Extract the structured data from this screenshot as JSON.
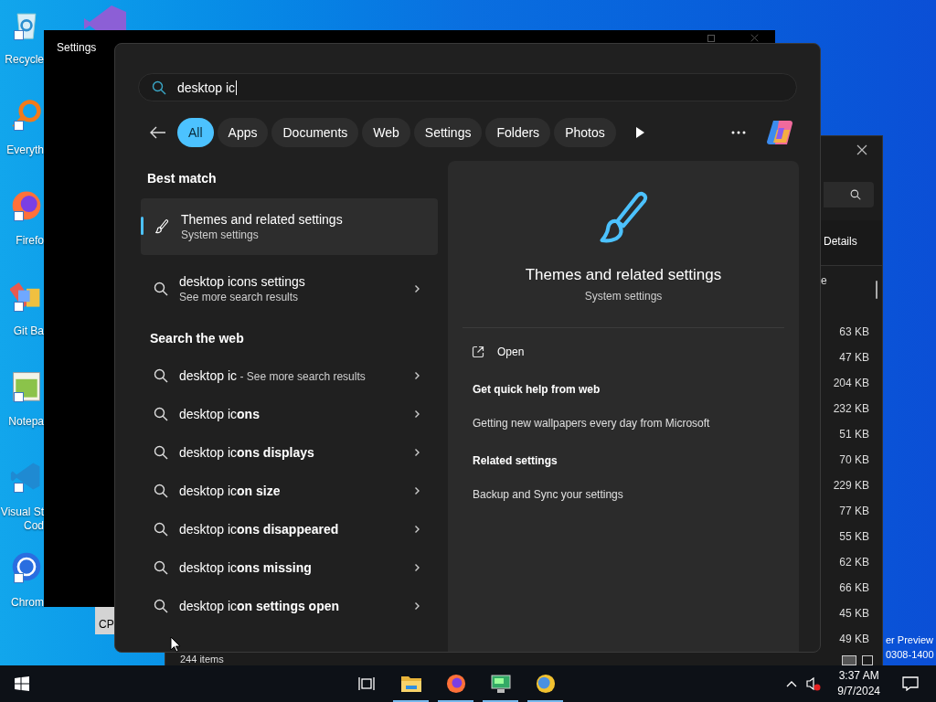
{
  "desktop": {
    "icons": [
      {
        "kind": "recycle-bin",
        "label": "Recycle"
      },
      {
        "kind": "magnifier",
        "label": "Everyth"
      },
      {
        "kind": "firefox",
        "label": "Firefo"
      },
      {
        "kind": "git",
        "label": "Git Ba"
      },
      {
        "kind": "notepad",
        "label": "Notepa"
      },
      {
        "kind": "vscode",
        "label": "Visual St\nCod"
      },
      {
        "kind": "chrome",
        "label": "Chrom"
      }
    ],
    "build_text": [
      "er Preview",
      "0308-1400"
    ]
  },
  "settings_window": {
    "title": "Settings"
  },
  "background_window": {
    "label": "CP"
  },
  "explorer": {
    "toolbar_button": "Details",
    "column_header": "e",
    "sizes": [
      "63 KB",
      "47 KB",
      "204 KB",
      "232 KB",
      "51 KB",
      "70 KB",
      "229 KB",
      "77 KB",
      "55 KB",
      "62 KB",
      "66 KB",
      "45 KB",
      "49 KB"
    ],
    "status": "244 items"
  },
  "search": {
    "query": "desktop ic",
    "filters": [
      {
        "label": "All",
        "selected": true
      },
      {
        "label": "Apps",
        "selected": false
      },
      {
        "label": "Documents",
        "selected": false
      },
      {
        "label": "Web",
        "selected": false
      },
      {
        "label": "Settings",
        "selected": false
      },
      {
        "label": "Folders",
        "selected": false
      },
      {
        "label": "Photos",
        "selected": false
      }
    ],
    "best_match_heading": "Best match",
    "best_match": {
      "title": "Themes and related settings",
      "subtitle": "System settings",
      "selected": true
    },
    "suggestion": {
      "text": "desktop icons settings",
      "subtitle": "See more search results"
    },
    "web_heading": "Search the web",
    "web_results": [
      {
        "text": "desktop ic",
        "note": "- See more search results"
      },
      {
        "text": "desktop ic**ons**"
      },
      {
        "text": "desktop ic**ons displays**"
      },
      {
        "text": "desktop ic**on size**"
      },
      {
        "text": "desktop ic**ons disappeared**"
      },
      {
        "text": "desktop ic**ons missing**"
      },
      {
        "text": "desktop ic**on settings open**"
      }
    ],
    "detail": {
      "title": "Themes and related settings",
      "subtitle": "System settings",
      "open": "Open",
      "help_heading": "Get quick help from web",
      "help_link": "Getting new wallpapers every day from Microsoft",
      "related_heading": "Related settings",
      "related_link": "Backup and Sync your settings"
    }
  },
  "taskbar": {
    "apps": [
      {
        "kind": "folder",
        "running": true
      },
      {
        "kind": "firefox",
        "running": true
      },
      {
        "kind": "monitor",
        "running": true
      },
      {
        "kind": "chrome",
        "running": true
      }
    ],
    "time": "3:37 AM",
    "date": "9/7/2024"
  }
}
